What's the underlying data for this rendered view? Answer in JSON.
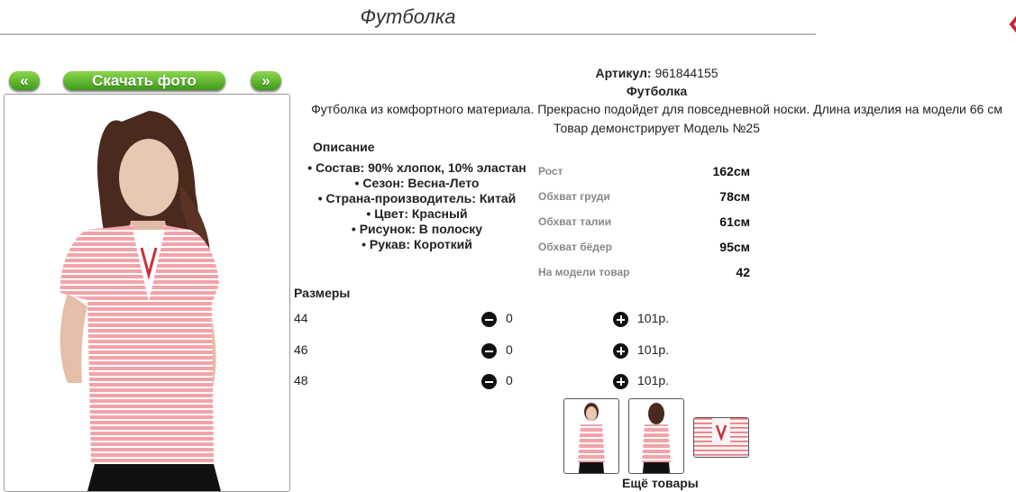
{
  "page": {
    "title": "Футболка"
  },
  "nav": {
    "prev_label": "«",
    "download_label": "Скачать фото",
    "next_label": "»"
  },
  "product": {
    "article_label": "Артикул:",
    "article_value": "961844155",
    "name": "Футболка",
    "description": "Футболка из комфортного материала. Прекрасно подойдет для повседневной носки. Длина изделия на модели 66 см",
    "model_note": "Товар демонстрирует Модель №25"
  },
  "description_heading": "Описание",
  "specs": [
    "Состав: 90% хлопок, 10% эластан",
    "Сезон: Весна-Лето",
    "Страна-производитель: Китай",
    "Цвет: Красный",
    "Рисунок: В полоску",
    "Рукав: Короткий"
  ],
  "measurements": [
    {
      "label": "Рост",
      "value": "162см"
    },
    {
      "label": "Обхват груди",
      "value": "78см"
    },
    {
      "label": "Обхват талии",
      "value": "61см"
    },
    {
      "label": "Обхват бёдер",
      "value": "95см"
    },
    {
      "label": "На модели товар",
      "value": "42"
    }
  ],
  "sizes_heading": "Размеры",
  "sizes": [
    {
      "size": "44",
      "qty": "0",
      "price": "101р."
    },
    {
      "size": "46",
      "qty": "0",
      "price": "101р."
    },
    {
      "size": "48",
      "qty": "0",
      "price": "101р."
    }
  ],
  "more_label": "Ещё товары",
  "colors": {
    "accent_green": "#3f9a1b",
    "stripe_red": "#e8727a",
    "minus_plus": "#111111"
  },
  "icons": {
    "minus": "minus-circle-icon",
    "plus": "plus-circle-icon"
  }
}
